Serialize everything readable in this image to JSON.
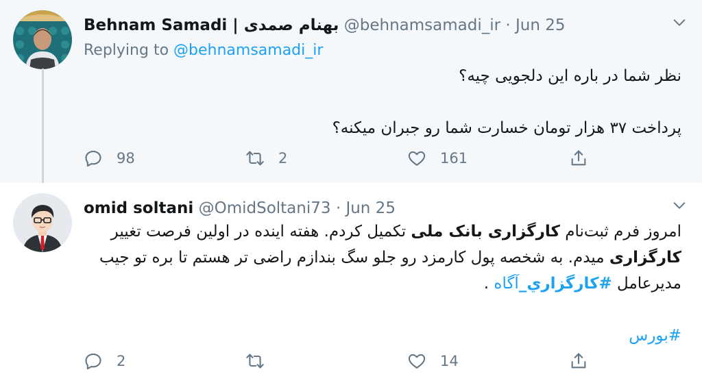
{
  "tweets": [
    {
      "name": "Behnam Samadi | بهنام صمدی",
      "handle": "@behnamsamadi_ir",
      "date": "Jun 25",
      "reply_to_prefix": "Replying to",
      "reply_to_handle": "@behnamsamadi_ir",
      "body_line1": "نظر شما در باره این دلجویی چیه؟",
      "body_line2": "پرداخت ۳۷ هزار تومان خسارت شما رو جبران میکنه؟",
      "replies": "98",
      "retweets": "2",
      "likes": "161"
    },
    {
      "name": "omid soltani",
      "handle": "@OmidSoltani73",
      "date": "Jun 25",
      "body_p1_a": "امروز فرم ثبت‌نام ",
      "body_p1_bold1": "کارگزاری بانک ملی",
      "body_p1_b": " تکمیل کردم. هفته اینده در اولین فرصت تغییر ",
      "body_p1_bold2": "کارگزاری",
      "body_p1_c": " میدم. به شخصه پول کارمزد رو جلو سگ بندازم راضی تر هستم تا بره تو جیب مدیرعامل ",
      "hashtag1": "#کارگزاري_",
      "hashtag1_tail": "آگاه",
      "body_p1_end": " .",
      "hashtag2": "#بورس",
      "replies": "2",
      "retweets": "",
      "likes": "14"
    }
  ],
  "colors": {
    "accent": "#1da1f2",
    "muted": "#657786",
    "highlight_bg": "#f5f8fa"
  },
  "icons": [
    "reply-icon",
    "retweet-icon",
    "like-icon",
    "share-icon",
    "chevron-down-icon"
  ]
}
